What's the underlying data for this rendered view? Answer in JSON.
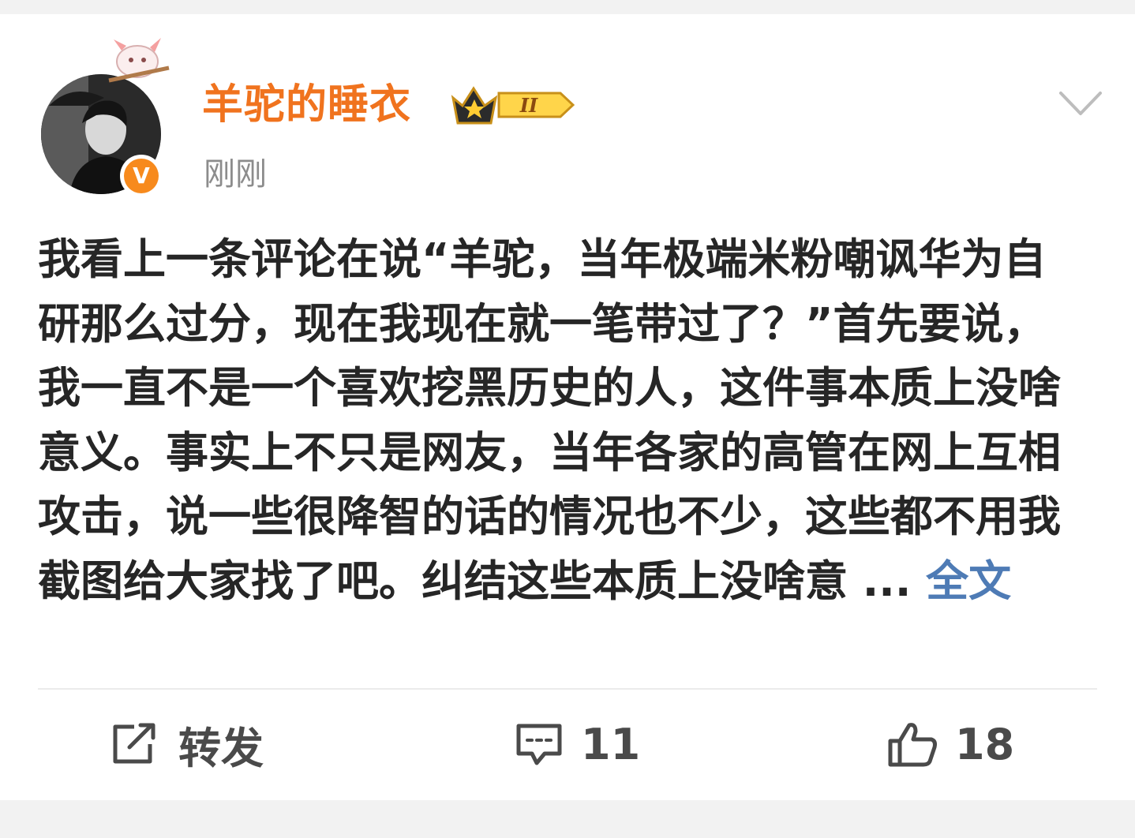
{
  "post": {
    "username": "羊驼的睡衣",
    "member_level": "II",
    "timestamp": "刚刚",
    "verified_badge": "V",
    "body": "我看上一条评论在说“羊驼，当年极端米粉嘲讽华为自研那么过分，现在我现在就一笔带过了？”首先要说，我一直不是一个喜欢挖黑历史的人，这件事本质上没啥意义。事实上不只是网友，当年各家的高管在网上互相攻击，说一些很降智的话的情况也不少，这些都不用我截图给大家找了吧。纠结这些本质上没啥意 ...",
    "full_text_link": "全文"
  },
  "actions": {
    "repost_label": "转发",
    "comment_count": "11",
    "like_count": "18"
  },
  "colors": {
    "username": "#f0731e",
    "link": "#4e7bb5",
    "timestamp": "#8c8c8c",
    "body_text": "#262626",
    "verified_badge": "#f78a1d"
  },
  "icons": {
    "more": "chevron-down-icon",
    "repost": "share-edit-icon",
    "comment": "comment-icon",
    "like": "thumbs-up-icon",
    "verified": "verified-v-icon",
    "member": "crown-icon"
  }
}
